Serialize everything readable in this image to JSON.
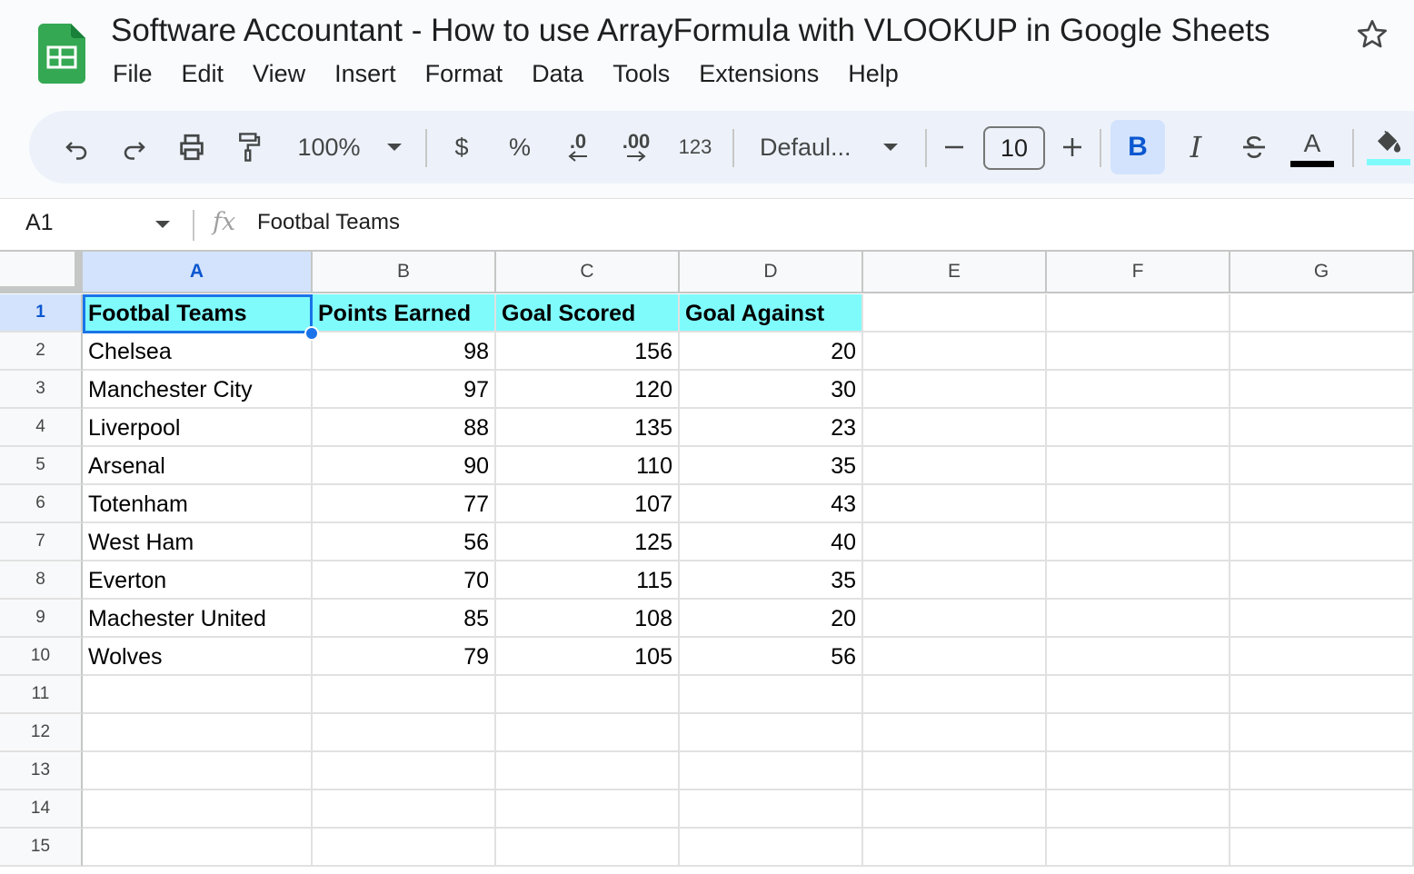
{
  "app": {
    "title": "Software Accountant - How to use ArrayFormula with VLOOKUP in Google Sheets"
  },
  "menu": [
    "File",
    "Edit",
    "View",
    "Insert",
    "Format",
    "Data",
    "Tools",
    "Extensions",
    "Help"
  ],
  "toolbar": {
    "zoom": "100%",
    "currency": "$",
    "percent": "%",
    "decrease_decimal": ".0",
    "increase_decimal": ".00",
    "more_formats": "123",
    "font": "Defaul...",
    "font_size": "10",
    "bold": "B",
    "italic": "I",
    "text_color_label": "A",
    "text_color": "#000000",
    "fill_color": "#7ffbfc"
  },
  "formula_bar": {
    "cell_ref": "A1",
    "content": "Footbal Teams"
  },
  "sheet": {
    "columns": [
      "A",
      "B",
      "C",
      "D",
      "E",
      "F",
      "G"
    ],
    "row_numbers": [
      "1",
      "2",
      "3",
      "4",
      "5",
      "6",
      "7",
      "8",
      "9",
      "10",
      "11",
      "12",
      "13",
      "14",
      "15"
    ],
    "headers": [
      "Footbal Teams",
      "Points Earned",
      "Goal Scored",
      "Goal Against"
    ],
    "rows": [
      [
        "Chelsea",
        "98",
        "156",
        "20"
      ],
      [
        "Manchester City",
        "97",
        "120",
        "30"
      ],
      [
        "Liverpool",
        "88",
        "135",
        "23"
      ],
      [
        "Arsenal",
        "90",
        "110",
        "35"
      ],
      [
        "Totenham",
        "77",
        "107",
        "43"
      ],
      [
        "West Ham",
        "56",
        "125",
        "40"
      ],
      [
        "Everton",
        "70",
        "115",
        "35"
      ],
      [
        "Machester United",
        "85",
        "108",
        "20"
      ],
      [
        "Wolves",
        "79",
        "105",
        "56"
      ]
    ],
    "selected_cell": "A1",
    "header_fill": "#7ffbfc",
    "selection_color": "#1a73e8"
  }
}
